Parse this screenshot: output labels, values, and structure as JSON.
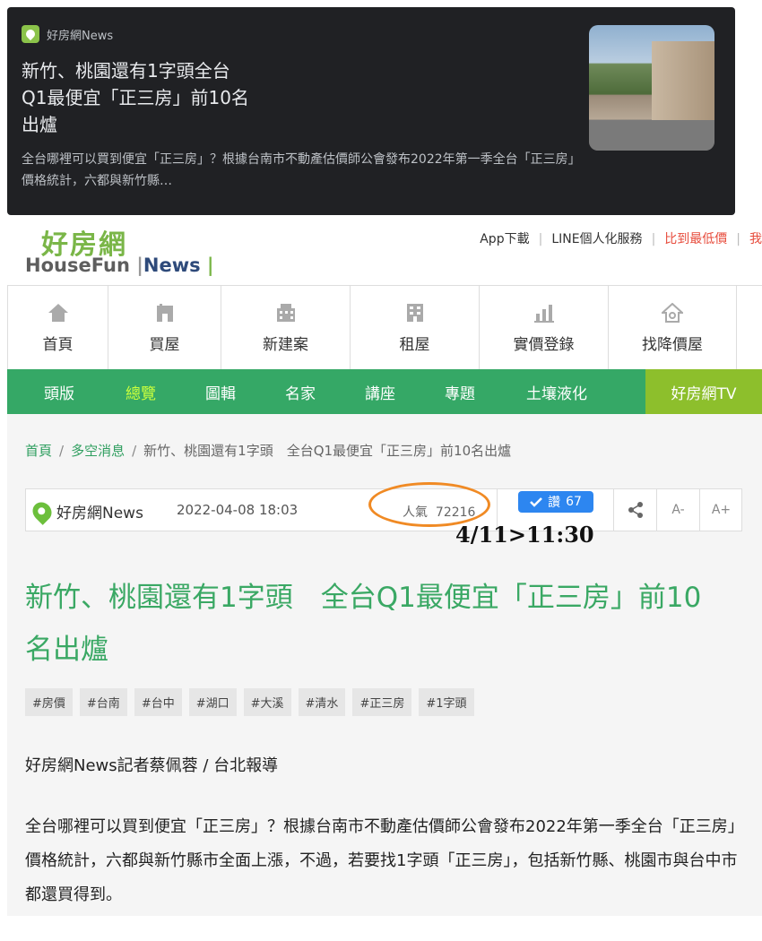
{
  "card": {
    "source": "好房網News",
    "title": "新竹、桃園還有1字頭全台Q1最便宜「正三房」前10名出爐",
    "snippet": "全台哪裡可以買到便宜「正三房」？根據台南市不動產估價師公會發布2022年第一季全台「正三房」價格統計，六都與新竹縣…"
  },
  "header": {
    "logo_main": "好房網",
    "logo_sub_left": "HouseFun",
    "logo_sub_right": "News",
    "links": [
      "App下載",
      "LINE個人化服務",
      "比到最低價",
      "我"
    ]
  },
  "icon_nav": [
    {
      "label": "首頁",
      "icon": "home-icon"
    },
    {
      "label": "買屋",
      "icon": "house-icon"
    },
    {
      "label": "新建案",
      "icon": "building-icon"
    },
    {
      "label": "租屋",
      "icon": "apartment-icon"
    },
    {
      "label": "實價登錄",
      "icon": "bar-chart-icon"
    },
    {
      "label": "找降價屋",
      "icon": "discount-house-icon"
    }
  ],
  "green_nav": [
    "頭版",
    "總覽",
    "圖輯",
    "名家",
    "講座",
    "專題",
    "土壤液化",
    "好房網TV"
  ],
  "breadcrumb": [
    "首頁",
    "多空消息",
    "新竹、桃園還有1字頭　全台Q1最便宜「正三房」前10名出爐"
  ],
  "meta": {
    "source": "好房網News",
    "date": "2022-04-08 18:03",
    "popularity_label": "人氣",
    "popularity": "72216",
    "like_label": "讚",
    "like_count": "67",
    "font_small": "A-",
    "font_large": "A+"
  },
  "annotation": "4/11>11:30",
  "article": {
    "title": "新竹、桃園還有1字頭　全台Q1最便宜「正三房」前10名出爐",
    "tags": [
      "#房價",
      "#台南",
      "#台中",
      "#湖口",
      "#大溪",
      "#清水",
      "#正三房",
      "#1字頭"
    ],
    "byline": "好房網News記者蔡佩蓉 / 台北報導",
    "paragraph": "全台哪裡可以買到便宜「正三房」？根據台南市不動產估價師公會發布2022年第一季全台「正三房」價格統計，六都與新竹縣市全面上漲，不過，若要找1字頭「正三房」，包括新竹縣、桃園市與台中市都還買得到。"
  },
  "colors": {
    "brand_green": "#35a866",
    "title_green": "#3aa864",
    "tv_green": "#8dbf2c",
    "like_blue": "#2d86f0",
    "annotation_orange": "#f08a24"
  }
}
